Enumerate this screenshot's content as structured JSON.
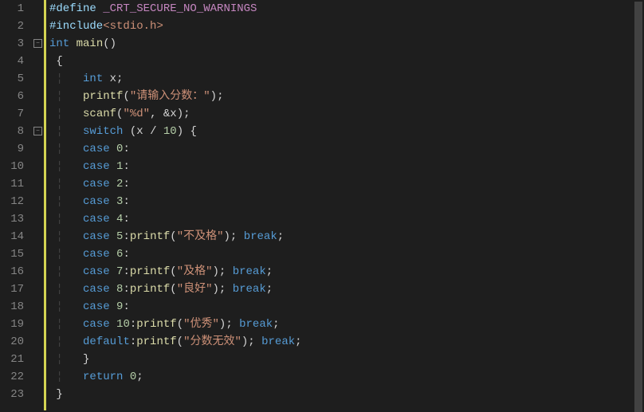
{
  "lineCount": 23,
  "foldMarkers": [
    {
      "line": 3,
      "symbol": "−"
    },
    {
      "line": 8,
      "symbol": "−"
    }
  ],
  "code": {
    "l1": {
      "preproc": "#define ",
      "macro": "_CRT_SECURE_NO_WARNINGS"
    },
    "l2": {
      "preproc": "#include",
      "lt": "<",
      "header": "stdio.h",
      "gt": ">"
    },
    "l3": {
      "type": "int ",
      "func": "main",
      "parens": "()"
    },
    "l4": {
      "brace": "{"
    },
    "l5": {
      "type": "int ",
      "var": "x",
      "semi": ";"
    },
    "l6": {
      "func": "printf",
      "lp": "(",
      "str": "\"请输入分数：\"",
      "rp": ")",
      "semi": ";"
    },
    "l7": {
      "func": "scanf",
      "lp": "(",
      "str": "\"%d\"",
      "comma": ", ",
      "amp": "&",
      "var": "x",
      "rp": ")",
      "semi": ";"
    },
    "l8": {
      "kw": "switch ",
      "lp": "(",
      "var": "x ",
      "op": "/ ",
      "num": "10",
      "rp": ") ",
      "lb": "{"
    },
    "l9": {
      "kw": "case ",
      "num": "0",
      "colon": ":"
    },
    "l10": {
      "kw": "case ",
      "num": "1",
      "colon": ":"
    },
    "l11": {
      "kw": "case ",
      "num": "2",
      "colon": ":"
    },
    "l12": {
      "kw": "case ",
      "num": "3",
      "colon": ":"
    },
    "l13": {
      "kw": "case ",
      "num": "4",
      "colon": ":"
    },
    "l14": {
      "kw": "case ",
      "num": "5",
      "colon": ":",
      "func": "printf",
      "lp": "(",
      "str": "\"不及格\"",
      "rp": ")",
      "semi1": "; ",
      "brk": "break",
      "semi2": ";"
    },
    "l15": {
      "kw": "case ",
      "num": "6",
      "colon": ":"
    },
    "l16": {
      "kw": "case ",
      "num": "7",
      "colon": ":",
      "func": "printf",
      "lp": "(",
      "str": "\"及格\"",
      "rp": ")",
      "semi1": "; ",
      "brk": "break",
      "semi2": ";"
    },
    "l17": {
      "kw": "case ",
      "num": "8",
      "colon": ":",
      "func": "printf",
      "lp": "(",
      "str": "\"良好\"",
      "rp": ")",
      "semi1": "; ",
      "brk": "break",
      "semi2": ";"
    },
    "l18": {
      "kw": "case ",
      "num": "9",
      "colon": ":"
    },
    "l19": {
      "kw": "case ",
      "num": "10",
      "colon": ":",
      "func": "printf",
      "lp": "(",
      "str": "\"优秀\"",
      "rp": ")",
      "semi1": "; ",
      "brk": "break",
      "semi2": ";"
    },
    "l20": {
      "kw": "default",
      "colon": ":",
      "func": "printf",
      "lp": "(",
      "str": "\"分数无效\"",
      "rp": ")",
      "semi1": "; ",
      "brk": "break",
      "semi2": ";"
    },
    "l21": {
      "brace": "}"
    },
    "l22": {
      "kw": "return ",
      "num": "0",
      "semi": ";"
    },
    "l23": {
      "brace": "}"
    }
  }
}
